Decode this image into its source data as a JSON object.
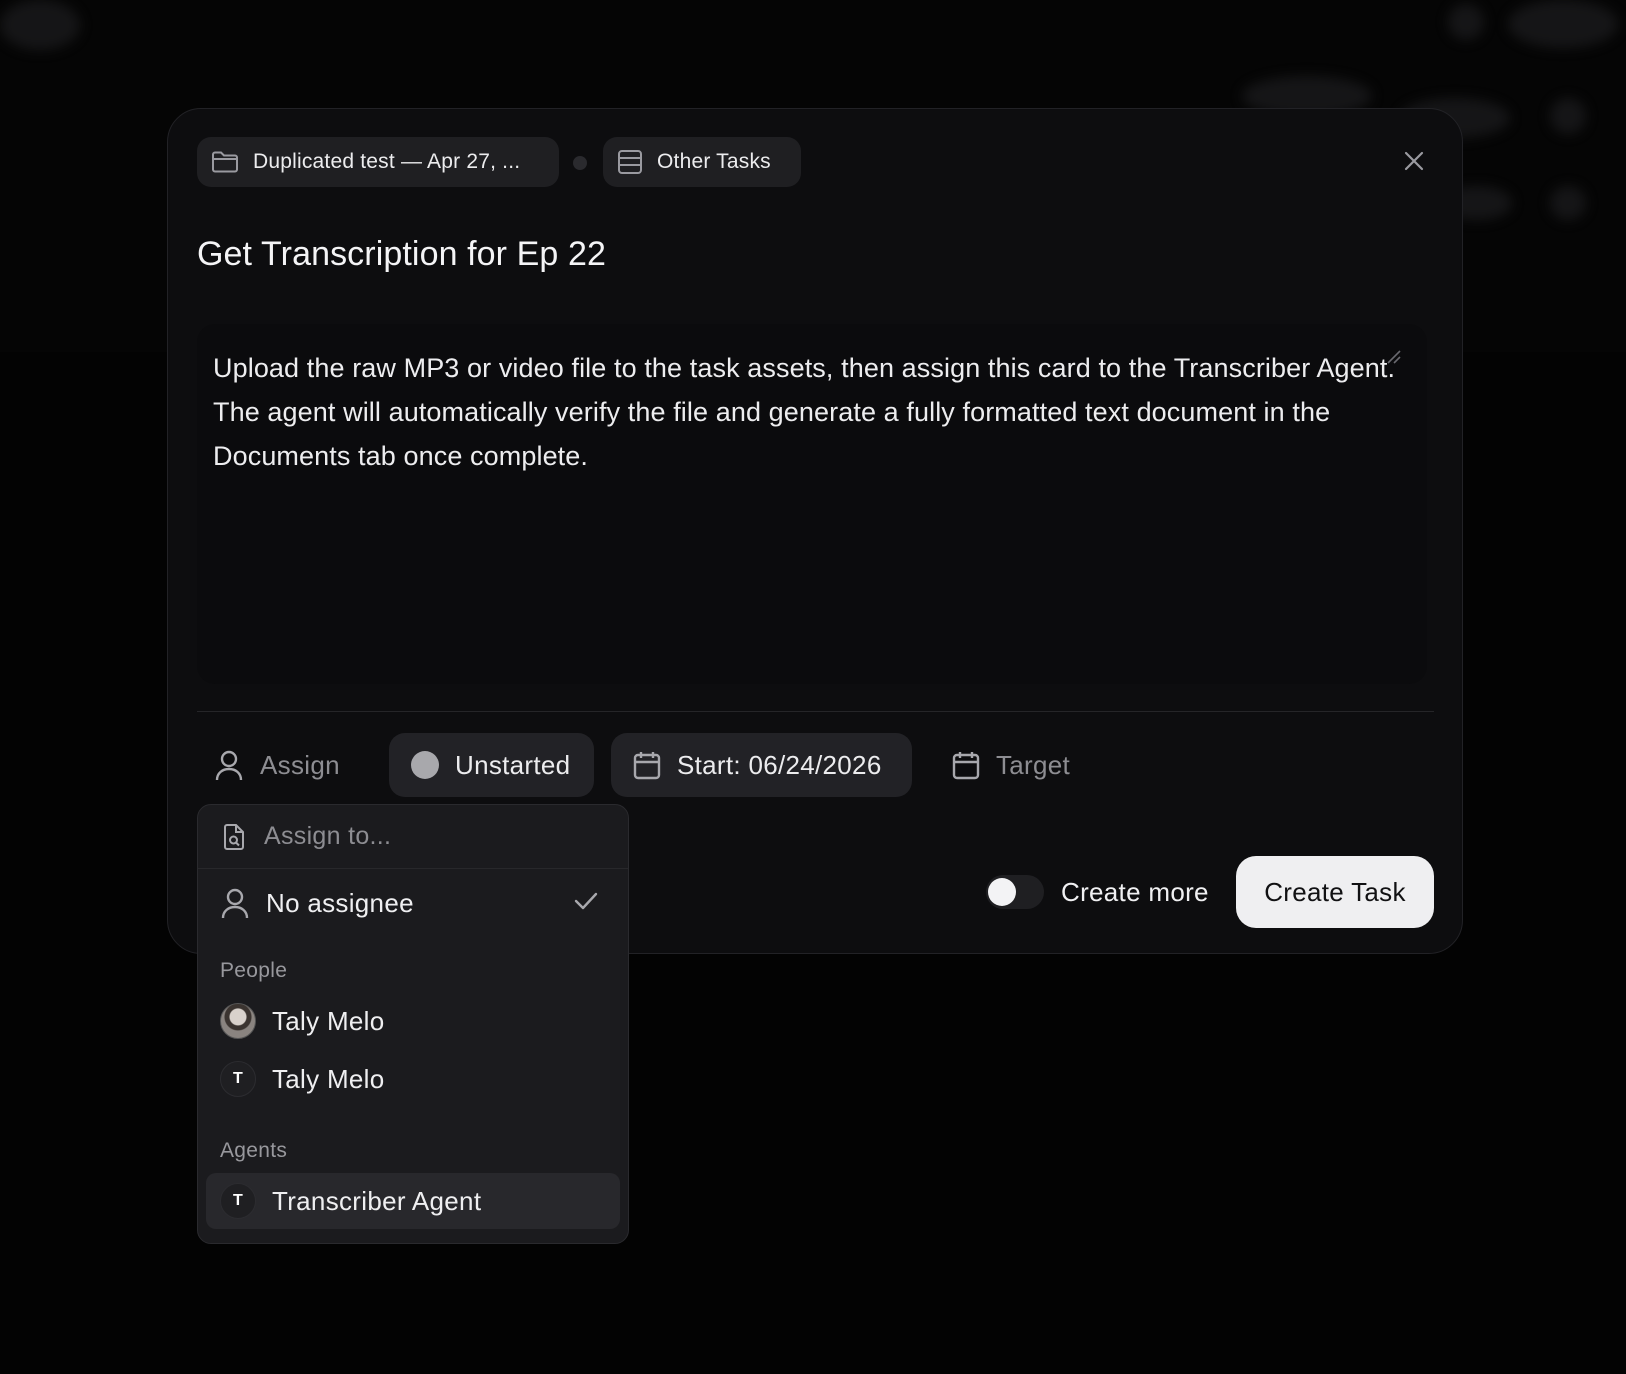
{
  "breadcrumbs": {
    "project": "Duplicated test — Apr 27, ...",
    "list": "Other Tasks"
  },
  "task": {
    "title": "Get Transcription for Ep 22",
    "description": "Upload the raw MP3 or video file to the task assets, then assign this card to the Transcriber Agent. The agent will automatically verify the file and generate a fully formatted text document in the Documents tab once complete."
  },
  "properties": {
    "assign_label": "Assign",
    "status_label": "Unstarted",
    "start_label": "Start: 06/24/2026",
    "target_label": "Target"
  },
  "footer": {
    "create_more_label": "Create more",
    "create_more_enabled": false,
    "create_button_label": "Create Task"
  },
  "assign_dropdown": {
    "search_placeholder": "Assign to...",
    "no_assignee_label": "No assignee",
    "no_assignee_selected": true,
    "people_header": "People",
    "people": [
      {
        "name": "Taly Melo",
        "avatar": "photo"
      },
      {
        "name": "Taly Melo",
        "avatar": "T"
      }
    ],
    "agents_header": "Agents",
    "agents": [
      {
        "name": "Transcriber Agent",
        "avatar": "T"
      }
    ]
  },
  "colors": {
    "background": "#000000",
    "modal": "#0d0d0f",
    "pill": "#222226",
    "primary_button": "#efeff1",
    "muted_text": "#8d8d92"
  }
}
